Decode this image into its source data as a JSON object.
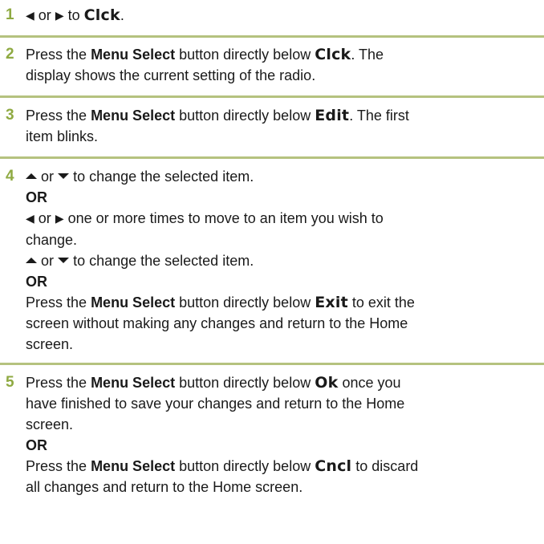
{
  "step1": {
    "num": "1",
    "or": "or",
    "text_to": "to",
    "display_clck": "Clck",
    "period": "."
  },
  "step2": {
    "num": "2",
    "press": "Press the",
    "menu_select": "Menu Select",
    "button_below": "button directly below",
    "display_clck": "Clck",
    "text_after": ". The",
    "line2": "display shows the current setting of the radio."
  },
  "step3": {
    "num": "3",
    "press": "Press the",
    "menu_select": "Menu Select",
    "button_below": "button directly below",
    "display_edit": "Edit",
    "text_after": ". The first",
    "line2": "item blinks."
  },
  "step4": {
    "num": "4",
    "l1_or": "or",
    "l1_rest": "to change the selected item.",
    "or1": "OR",
    "l3_or": "or",
    "l3_rest": "one or more times to move to an item you wish to",
    "l4": "change.",
    "l5_or": "or",
    "l5_rest": "to change the selected item.",
    "or2": "OR",
    "press": "Press the",
    "menu_select": "Menu Select",
    "button_below": "button directly below",
    "display_exit": "Exit",
    "l7_rest": "to exit the",
    "l8": "screen without making any changes and return to the Home",
    "l9": "screen."
  },
  "step5": {
    "num": "5",
    "press": "Press the",
    "menu_select": "Menu Select",
    "button_below": "button directly below",
    "display_ok": "Ok",
    "l1_rest": "once you",
    "l2": "have finished to save your changes and return to the Home",
    "l3": "screen.",
    "or": "OR",
    "press2": "Press the",
    "menu_select2": "Menu Select",
    "button_below2": "button directly below",
    "display_cncl": "Cncl",
    "l5_rest": "to discard",
    "l6": "all changes and return to the Home screen."
  },
  "icons": {
    "left": "left-arrow-icon",
    "right": "right-arrow-icon",
    "up": "up-arrow-icon",
    "down": "down-arrow-icon"
  },
  "colors": {
    "step_number": "#8faa42",
    "divider": "#b5c27f",
    "text": "#1a1a1a"
  }
}
